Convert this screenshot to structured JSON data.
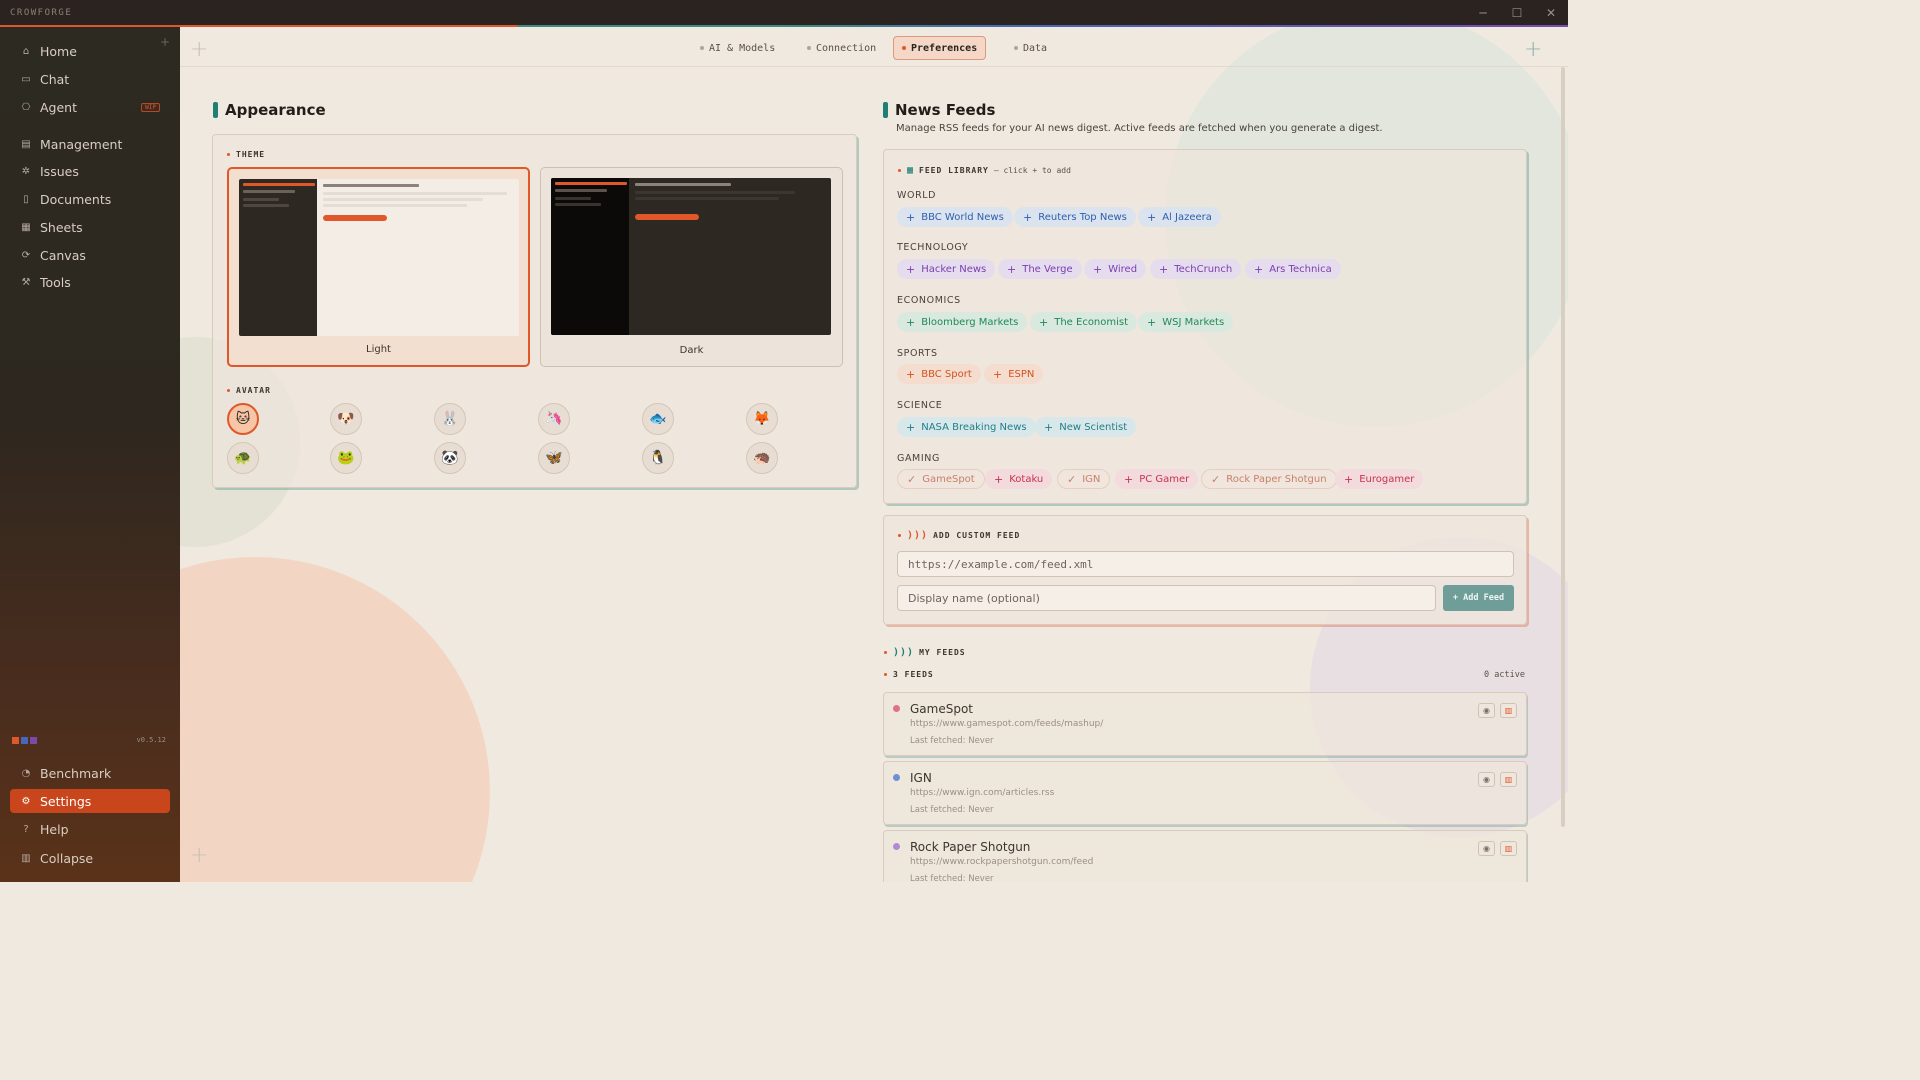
{
  "app": {
    "name": "CROWFORGE",
    "version": "v0.5.12"
  },
  "window_controls": {
    "minimize": "─",
    "maximize": "☐",
    "close": "✕"
  },
  "sidebar": {
    "items": [
      {
        "label": "Home",
        "icon": "home-icon",
        "glyph": "⌂"
      },
      {
        "label": "Chat",
        "icon": "chat-icon",
        "glyph": "▭"
      },
      {
        "label": "Agent",
        "icon": "agent-icon",
        "glyph": "⎔",
        "badge": "WIP"
      },
      {
        "label": "Management",
        "icon": "management-icon",
        "glyph": "▤"
      },
      {
        "label": "Issues",
        "icon": "issues-icon",
        "glyph": "✲"
      },
      {
        "label": "Documents",
        "icon": "documents-icon",
        "glyph": "▯"
      },
      {
        "label": "Sheets",
        "icon": "sheets-icon",
        "glyph": "▦"
      },
      {
        "label": "Canvas",
        "icon": "canvas-icon",
        "glyph": "⟳"
      },
      {
        "label": "Tools",
        "icon": "tools-icon",
        "glyph": "⚒"
      }
    ],
    "bottom": [
      {
        "label": "Benchmark",
        "icon": "benchmark-icon",
        "glyph": "◔"
      },
      {
        "label": "Settings",
        "icon": "settings-icon",
        "glyph": "⚙",
        "active": true
      },
      {
        "label": "Help",
        "icon": "help-icon",
        "glyph": "?"
      },
      {
        "label": "Collapse",
        "icon": "collapse-icon",
        "glyph": "▥"
      }
    ],
    "swatches": [
      "#e0572a",
      "#4a66b8",
      "#7b4aa8"
    ]
  },
  "tabs": [
    {
      "label": "AI & Models"
    },
    {
      "label": "Connection"
    },
    {
      "label": "Preferences",
      "active": true
    },
    {
      "label": "Data"
    }
  ],
  "appearance": {
    "title": "Appearance",
    "theme_label": "THEME",
    "themes": [
      {
        "name": "Light",
        "selected": true
      },
      {
        "name": "Dark"
      }
    ],
    "avatar_label": "AVATAR",
    "avatars": [
      "🐱",
      "🐶",
      "🐰",
      "🦄",
      "🐟",
      "🦊",
      "🐢",
      "🐸",
      "🐼",
      "🦋",
      "🐧",
      "🦔"
    ]
  },
  "news": {
    "title": "News Feeds",
    "subtitle": "Manage RSS feeds for your AI news digest. Active feeds are fetched when you generate a digest.",
    "library_label": "FEED LIBRARY",
    "library_hint": "— click + to add",
    "categories": [
      {
        "name": "WORLD",
        "feeds": [
          "BBC World News",
          "Reuters Top News",
          "Al Jazeera"
        ]
      },
      {
        "name": "TECHNOLOGY",
        "feeds": [
          "Hacker News",
          "The Verge",
          "Wired",
          "TechCrunch",
          "Ars Technica"
        ]
      },
      {
        "name": "ECONOMICS",
        "feeds": [
          "Bloomberg Markets",
          "The Economist",
          "WSJ Markets"
        ]
      },
      {
        "name": "SPORTS",
        "feeds": [
          "BBC Sport",
          "ESPN"
        ]
      },
      {
        "name": "SCIENCE",
        "feeds": [
          "NASA Breaking News",
          "New Scientist"
        ]
      },
      {
        "name": "GAMING",
        "feeds": [
          "GameSpot",
          "Kotaku",
          "IGN",
          "PC Gamer",
          "Rock Paper Shotgun",
          "Eurogamer"
        ],
        "added": [
          "GameSpot",
          "IGN",
          "Rock Paper Shotgun"
        ]
      }
    ],
    "add_custom": {
      "label": "ADD CUSTOM FEED",
      "url_placeholder": "https://example.com/feed.xml",
      "name_placeholder": "Display name (optional)",
      "button": "+ Add Feed"
    },
    "my_feeds": {
      "label": "MY FEEDS",
      "count": "3 FEEDS",
      "active": "0 active",
      "feeds": [
        {
          "name": "GameSpot",
          "url": "https://www.gamespot.com/feeds/mashup/",
          "last": "Last fetched: Never",
          "color": "#e0708e"
        },
        {
          "name": "IGN",
          "url": "https://www.ign.com/articles.rss",
          "last": "Last fetched: Never",
          "color": "#6e8fd8"
        },
        {
          "name": "Rock Paper Shotgun",
          "url": "https://www.rockpapershotgun.com/feed",
          "last": "Last fetched: Never",
          "color": "#b08ad8"
        }
      ]
    }
  }
}
